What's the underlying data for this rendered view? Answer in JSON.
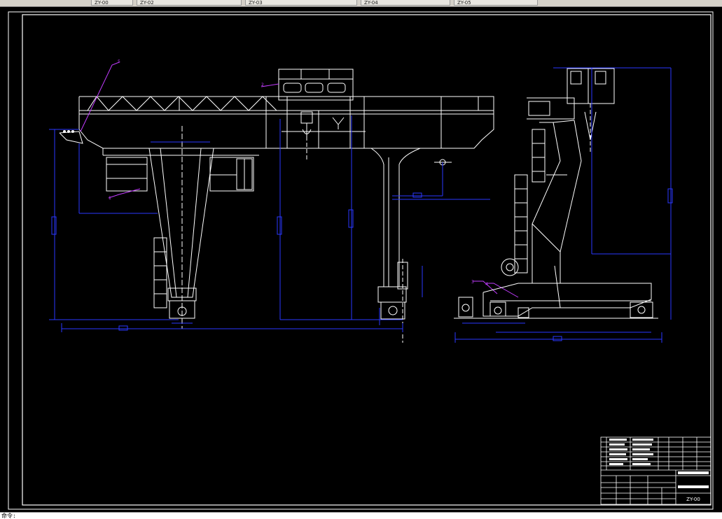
{
  "taskbar": {
    "buttons": [
      "ZY-00",
      "ZY-02",
      "ZY-03",
      "ZY-04",
      "ZY-05"
    ]
  },
  "title_block": {
    "drawing_number": "ZY-00"
  },
  "status": {
    "command_prompt": "命令:"
  },
  "colors": {
    "background": "#000000",
    "lines": "#ffffff",
    "dimensions": "#2a37ff",
    "leaders": "#c23cff"
  }
}
